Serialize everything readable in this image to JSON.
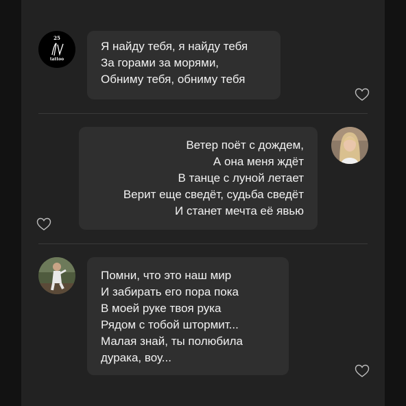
{
  "theme": {
    "background": "#121212",
    "panel": "#222222",
    "bubble": "#2f2f2f",
    "text": "#f2f2f2",
    "divider": "#3a3a3a",
    "icon": "#bdbdbd"
  },
  "messages": [
    {
      "avatar": {
        "type": "logo",
        "number": "25",
        "word": "tattoo"
      },
      "lines": [
        "Я найду тебя, я найду тебя",
        "За горами за морями,",
        "Обниму тебя, обниму тебя"
      ],
      "like_icon": "heart-outline-icon"
    },
    {
      "avatar": {
        "type": "photo",
        "icon": "person-photo-blonde"
      },
      "lines": [
        "Ветер поёт с дождем,",
        "А она меня ждёт",
        "В танце с луной летает",
        "Верит еще сведёт, судьба сведёт",
        "И станет мечта её явью"
      ],
      "like_icon": "heart-outline-icon"
    },
    {
      "avatar": {
        "type": "photo",
        "icon": "person-photo-outdoor"
      },
      "lines": [
        "Помни, что это наш мир",
        "И забирать его пора пока",
        "В моей руке твоя рука",
        "Рядом с тобой штормит...",
        "Малая знай, ты полюбила",
        "дурака, воу..."
      ],
      "like_icon": "heart-outline-icon"
    }
  ]
}
